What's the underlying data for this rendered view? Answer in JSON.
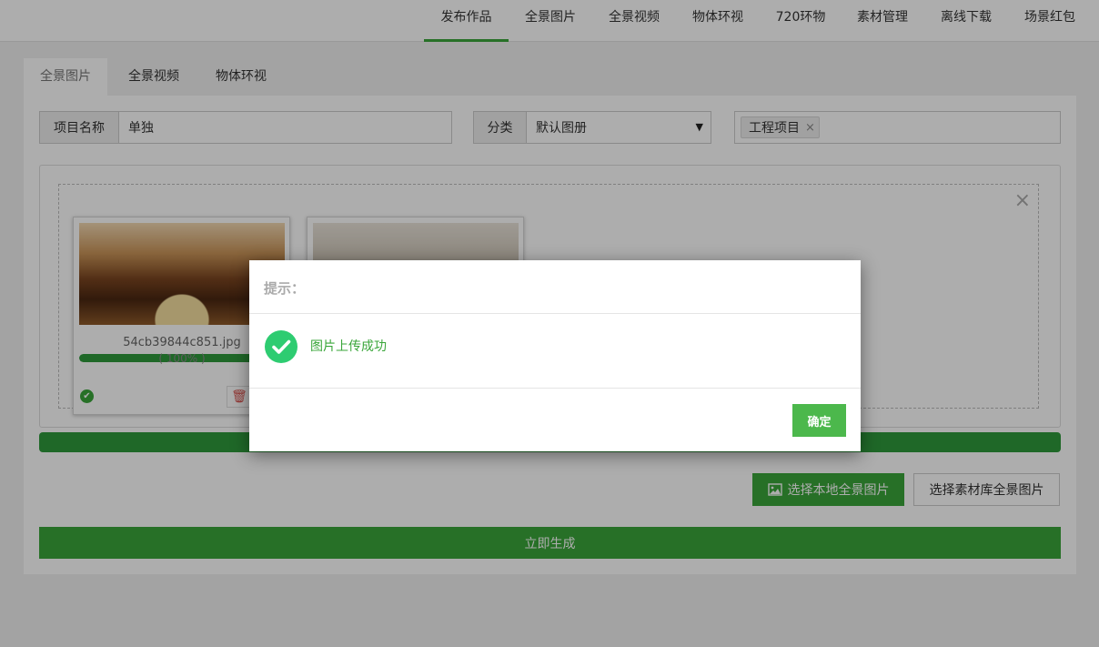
{
  "topnav": {
    "items": [
      "发布作品",
      "全景图片",
      "全景视频",
      "物体环视",
      "720环物",
      "素材管理",
      "离线下载",
      "场景红包"
    ],
    "active_index": 0
  },
  "tabs": [
    "全景图片",
    "全景视频",
    "物体环视"
  ],
  "form": {
    "project_name_label": "项目名称",
    "project_name_value": "单独",
    "category_label": "分类",
    "category_value": "默认图册",
    "tag": "工程项目",
    "tag_remove": "×"
  },
  "uploads": [
    {
      "file_name": "54cb39844c851.jpg",
      "progress_text": "( 100% )",
      "progress": 1.0
    },
    {
      "file_name": "",
      "progress_text": "",
      "progress": 1.0
    }
  ],
  "close_symbol": "×",
  "buttons": {
    "select_local": "选择本地全景图片",
    "select_library": "选择素材库全景图片",
    "generate": "立即生成"
  },
  "modal": {
    "title": "提示：",
    "message": "图片上传成功",
    "ok": "确定"
  },
  "colors": {
    "accent_green": "#3aa63a",
    "success_icon": "#2ecc71"
  },
  "icons": {
    "success": "check-circle-icon",
    "trash": "trash-icon",
    "image": "image-icon",
    "dropdown": "caret-down-icon"
  }
}
